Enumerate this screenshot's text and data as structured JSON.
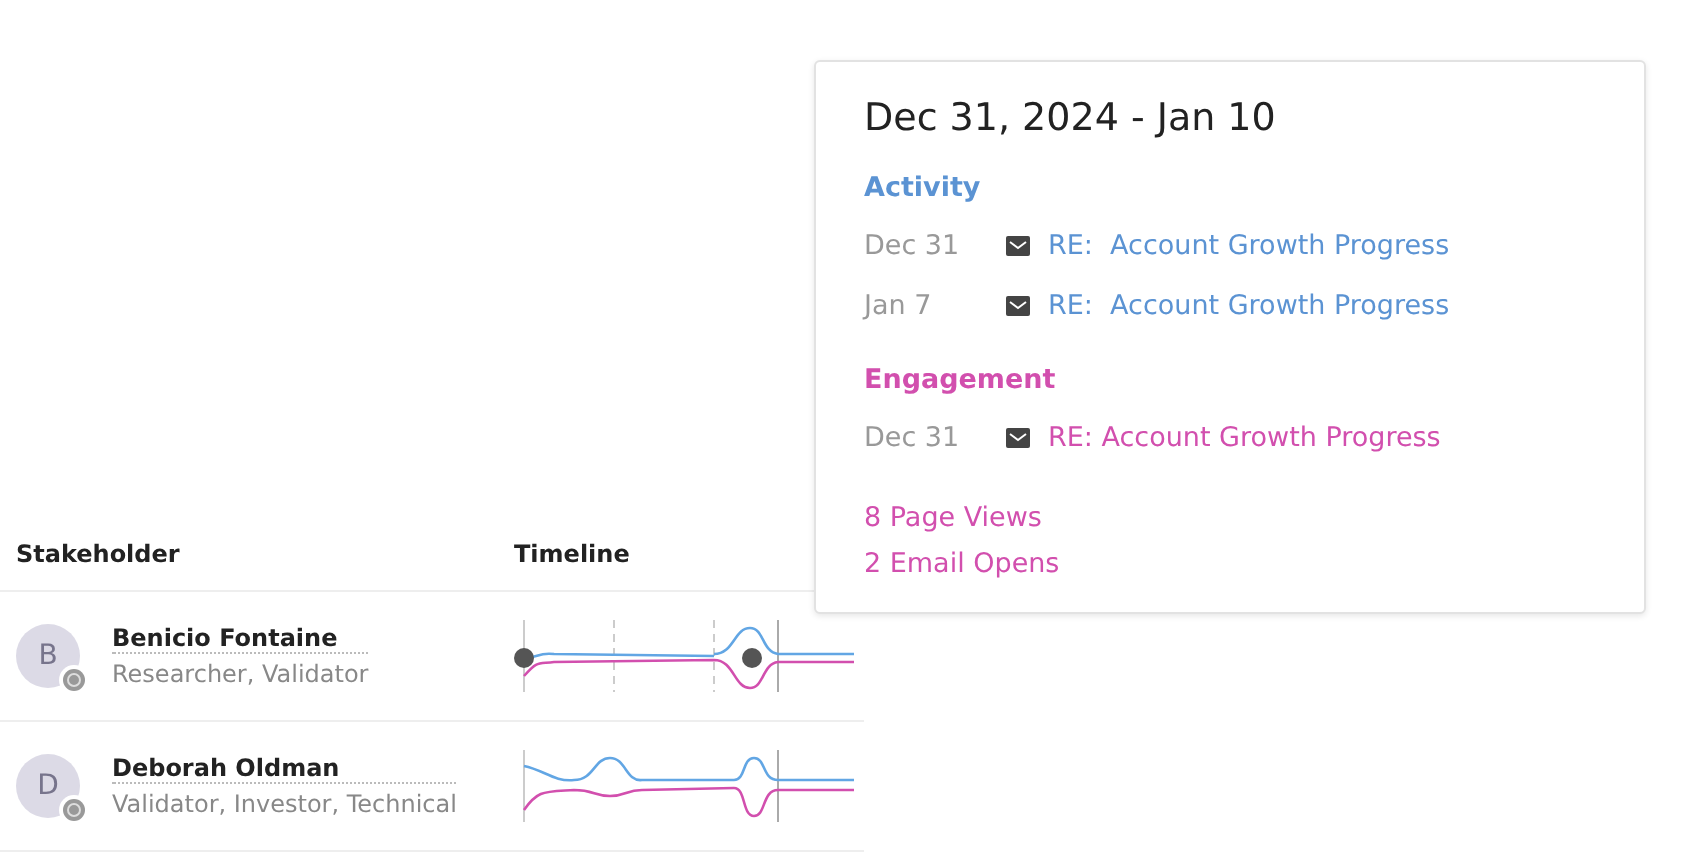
{
  "table": {
    "columns": [
      "Stakeholder",
      "Timeline"
    ],
    "rows": [
      {
        "initials": "B",
        "name": "Benicio Fontaine",
        "roles": "Researcher, Validator",
        "kind": "dots"
      },
      {
        "initials": "D",
        "name": "Deborah Oldman",
        "roles": "Validator, Investor, Technical",
        "kind": "waves"
      }
    ]
  },
  "popover": {
    "title": "Dec 31, 2024 - Jan 10",
    "sections": [
      {
        "kind": "activity",
        "heading": "Activity",
        "items": [
          {
            "date": "Dec 31",
            "subject": "RE:  Account Growth Progress"
          },
          {
            "date": "Jan 7",
            "subject": "RE:  Account Growth Progress"
          }
        ]
      },
      {
        "kind": "engagement",
        "heading": "Engagement",
        "items": [
          {
            "date": "Dec 31",
            "subject": "RE: Account Growth Progress"
          }
        ]
      }
    ],
    "stats": [
      "8 Page Views",
      "2 Email Opens"
    ]
  }
}
